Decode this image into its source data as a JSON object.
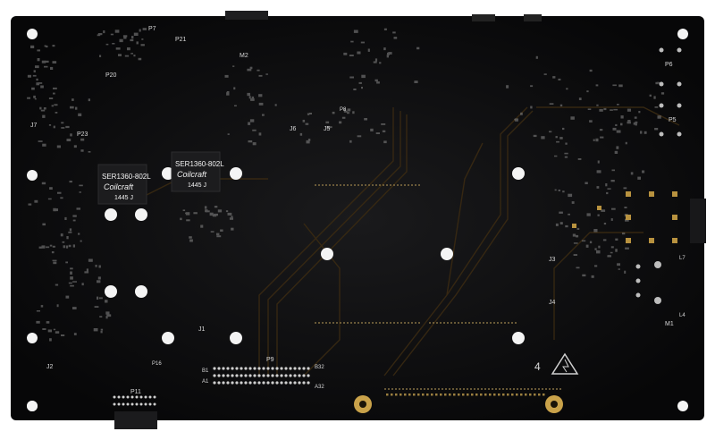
{
  "board": {
    "inductor_left": {
      "part": "SER1360-802L",
      "brand": "Coilcraft",
      "code": "1445 J"
    },
    "inductor_right": {
      "part": "SER1360-802L",
      "brand": "Coilcraft",
      "code": "1445 J"
    },
    "labels": {
      "p7": "P7",
      "p21": "P21",
      "m2": "M2",
      "p20": "P20",
      "j7": "J7",
      "p23": "P23",
      "p6": "P6",
      "p5": "P5",
      "j1": "J1",
      "j2": "J2",
      "j3": "J3",
      "j4": "J4",
      "p9": "P9",
      "b1": "B1",
      "a1": "A1",
      "b32": "B32",
      "a32": "A32",
      "p11": "P11",
      "p16": "P16",
      "j5": "J5",
      "j6": "J6",
      "p8": "P8",
      "m1": "M1",
      "l7": "L7",
      "l4": "L4",
      "rev": "4"
    },
    "colors": {
      "pcb": "#0b0b0c",
      "silkscreen": "#d8d8d8",
      "gold": "#c9a24a",
      "hole": "#f4f4f4",
      "trace": "#3a2a12"
    }
  }
}
